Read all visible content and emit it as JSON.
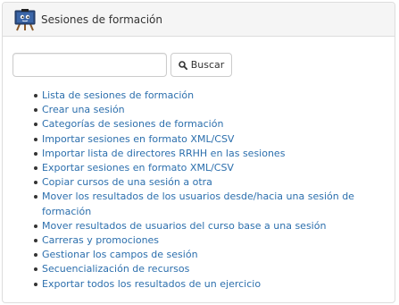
{
  "header": {
    "title": "Sesiones de formación",
    "icon": "training-sessions-icon"
  },
  "search": {
    "value": "",
    "placeholder": "",
    "button_label": "Buscar",
    "button_icon": "search-icon"
  },
  "menu": {
    "items": [
      {
        "label": "Lista de sesiones de formación"
      },
      {
        "label": "Crear una sesión"
      },
      {
        "label": "Categorías de sesiones de formación"
      },
      {
        "label": "Importar sesiones en formato XML/CSV"
      },
      {
        "label": "Importar lista de directores RRHH en las sesiones"
      },
      {
        "label": "Exportar sesiones en formato XML/CSV"
      },
      {
        "label": "Copiar cursos de una sesión a otra"
      },
      {
        "label": "Mover los resultados de los usuarios desde/hacia una sesión de formación"
      },
      {
        "label": "Mover resultados de usuarios del curso base a una sesión"
      },
      {
        "label": "Carreras y promociones"
      },
      {
        "label": "Gestionar los campos de sesión"
      },
      {
        "label": "Secuencialización de recursos"
      },
      {
        "label": "Exportar todos los resultados de un ejercicio"
      }
    ]
  },
  "colors": {
    "link": "#2c6fad",
    "heading_bg": "#f5f5f5",
    "border": "#dddddd"
  }
}
